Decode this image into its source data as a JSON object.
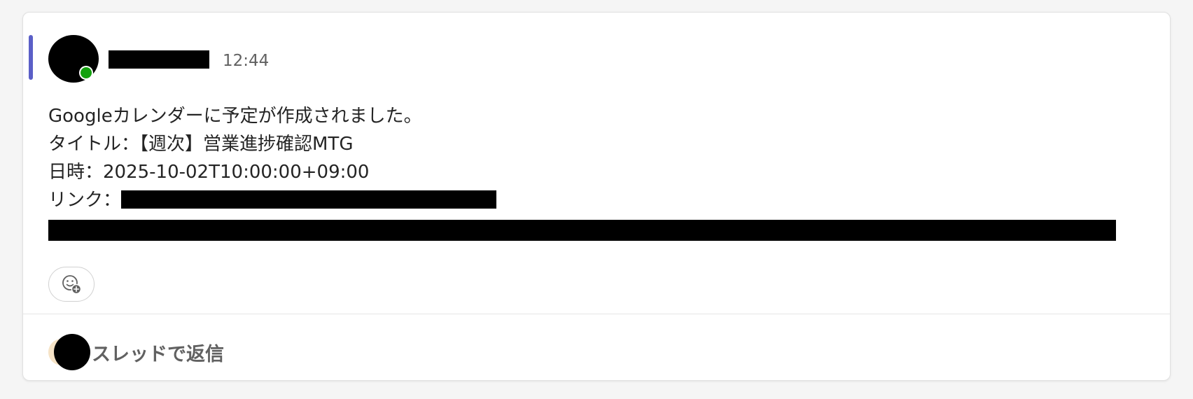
{
  "message": {
    "timestamp": "12:44",
    "body_lines": [
      "Googleカレンダーに予定が作成されました。",
      "タイトル：【週次】営業進捗確認MTG",
      "日時：2025-10-02T10:00:00+09:00"
    ],
    "link_label": "リンク："
  },
  "reactions": {
    "add_reaction_icon": "emoji-add-icon"
  },
  "thread": {
    "reply_label": "スレッドで返信"
  },
  "colors": {
    "accent": "#5b5fc7",
    "presence": "#13a10e",
    "background": "#f5f5f5",
    "card": "#ffffff"
  }
}
